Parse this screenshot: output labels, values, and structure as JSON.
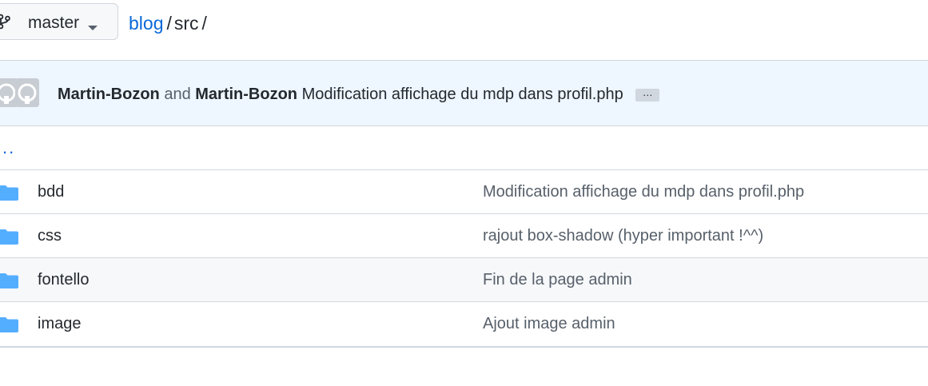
{
  "branch": {
    "name": "master",
    "icon": "git-branch-icon"
  },
  "breadcrumb": {
    "repo": "blog",
    "separator1": "/",
    "folder": "src",
    "separator2": "/"
  },
  "commit": {
    "author1": "Martin-Bozon",
    "conjunction": "and",
    "author2": "Martin-Bozon",
    "message": "Modification affichage du mdp dans profil.php",
    "ellipsis": "…"
  },
  "parent": {
    "label": ".."
  },
  "files": [
    {
      "name": "bdd",
      "type": "folder",
      "commit": "Modification affichage du mdp dans profil.php"
    },
    {
      "name": "css",
      "type": "folder",
      "commit": "rajout box-shadow (hyper important !^^)"
    },
    {
      "name": "fontello",
      "type": "folder",
      "commit": "Fin de la page admin"
    },
    {
      "name": "image",
      "type": "folder",
      "commit": "Ajout image admin"
    }
  ],
  "colors": {
    "link": "#0969da",
    "folder": "#54aeff",
    "commit_header_bg": "#eef6ff",
    "border": "#d0d7de"
  }
}
